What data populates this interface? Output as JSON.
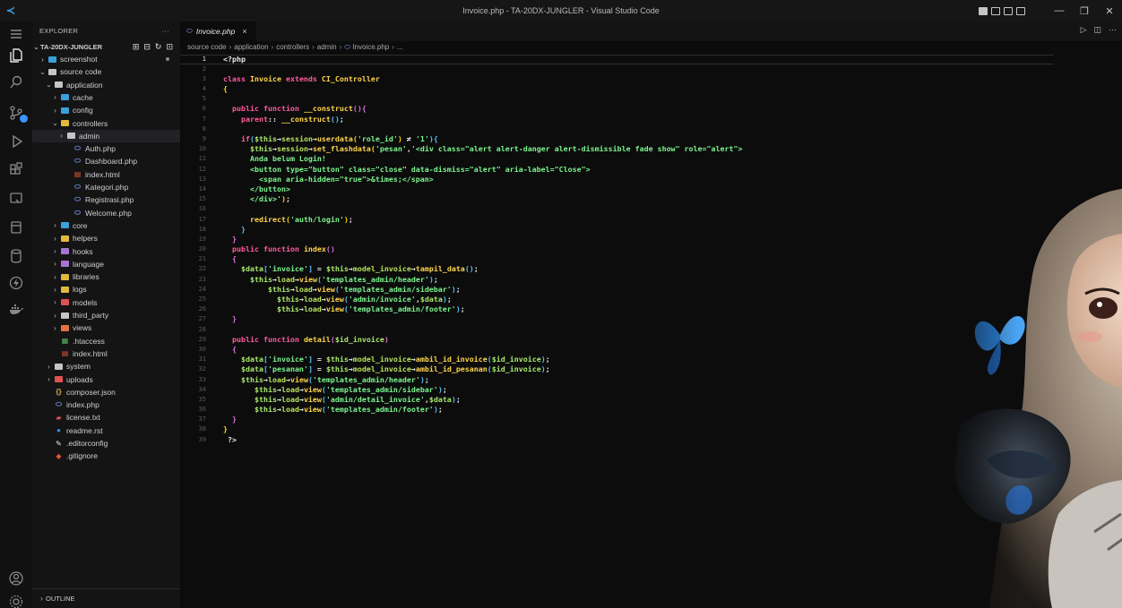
{
  "window": {
    "title": "Invoice.php - TA-20DX-JUNGLER - Visual Studio Code"
  },
  "explorer": {
    "header": "EXPLORER",
    "more": "···",
    "root": "TA-20DX-JUNGLER",
    "items": [
      {
        "label": "screenshot",
        "depth": 1,
        "type": "folder",
        "open": false,
        "color": "#3aa0d8",
        "dot": true
      },
      {
        "label": "source code",
        "depth": 1,
        "type": "folder",
        "open": true,
        "color": "#c5c5c5"
      },
      {
        "label": "application",
        "depth": 2,
        "type": "folder",
        "open": true,
        "color": "#c5c5c5"
      },
      {
        "label": "cache",
        "depth": 3,
        "type": "folder",
        "open": false,
        "color": "#3aa0d8"
      },
      {
        "label": "config",
        "depth": 3,
        "type": "folder",
        "open": false,
        "color": "#3aa0d8"
      },
      {
        "label": "controllers",
        "depth": 3,
        "type": "folder",
        "open": true,
        "color": "#e2b93d"
      },
      {
        "label": "admin",
        "depth": 4,
        "type": "folder",
        "open": false,
        "color": "#c5c5c5",
        "selected": true
      },
      {
        "label": "Auth.php",
        "depth": 5,
        "type": "php"
      },
      {
        "label": "Dashboard.php",
        "depth": 5,
        "type": "php"
      },
      {
        "label": "index.html",
        "depth": 5,
        "type": "html"
      },
      {
        "label": "Kategori.php",
        "depth": 5,
        "type": "php"
      },
      {
        "label": "Registrasi.php",
        "depth": 5,
        "type": "php"
      },
      {
        "label": "Welcome.php",
        "depth": 5,
        "type": "php"
      },
      {
        "label": "core",
        "depth": 3,
        "type": "folder",
        "open": false,
        "color": "#3aa0d8"
      },
      {
        "label": "helpers",
        "depth": 3,
        "type": "folder",
        "open": false,
        "color": "#e2b93d"
      },
      {
        "label": "hooks",
        "depth": 3,
        "type": "folder",
        "open": false,
        "color": "#a774d6"
      },
      {
        "label": "language",
        "depth": 3,
        "type": "folder",
        "open": false,
        "color": "#a774d6"
      },
      {
        "label": "libraries",
        "depth": 3,
        "type": "folder",
        "open": false,
        "color": "#e2b93d"
      },
      {
        "label": "logs",
        "depth": 3,
        "type": "folder",
        "open": false,
        "color": "#e2b93d"
      },
      {
        "label": "models",
        "depth": 3,
        "type": "folder",
        "open": false,
        "color": "#e05252"
      },
      {
        "label": "third_party",
        "depth": 3,
        "type": "folder",
        "open": false,
        "color": "#c5c5c5"
      },
      {
        "label": "views",
        "depth": 3,
        "type": "folder",
        "open": false,
        "color": "#e2733d"
      },
      {
        "label": ".htaccess",
        "depth": 3,
        "type": "htaccess"
      },
      {
        "label": "index.html",
        "depth": 3,
        "type": "html"
      },
      {
        "label": "system",
        "depth": 2,
        "type": "folder",
        "open": false,
        "color": "#c5c5c5"
      },
      {
        "label": "uploads",
        "depth": 2,
        "type": "folder",
        "open": false,
        "color": "#e05252"
      },
      {
        "label": "composer.json",
        "depth": 2,
        "type": "json"
      },
      {
        "label": "index.php",
        "depth": 2,
        "type": "php"
      },
      {
        "label": "license.txt",
        "depth": 2,
        "type": "license"
      },
      {
        "label": "readme.rst",
        "depth": 2,
        "type": "info"
      },
      {
        "label": ".editorconfig",
        "depth": 2,
        "type": "editorconfig"
      },
      {
        "label": ".gitignore",
        "depth": 2,
        "type": "git"
      }
    ],
    "outline": "OUTLINE"
  },
  "tab": {
    "label": "Invoice.php",
    "close": "×"
  },
  "breadcrumb": [
    "source code",
    "application",
    "controllers",
    "admin",
    "Invoice.php",
    "..."
  ],
  "editor": {
    "active_line": 1,
    "lines": [
      [
        [
          "php-tag",
          "<?php"
        ]
      ],
      [],
      [
        [
          "kw",
          "class "
        ],
        [
          "cls",
          "Invoice "
        ],
        [
          "kw",
          "extends "
        ],
        [
          "cls",
          "CI_Controller"
        ]
      ],
      [
        [
          "brk1",
          "{"
        ]
      ],
      [],
      [
        [
          "t",
          "  "
        ],
        [
          "kw",
          "public function "
        ],
        [
          "fn",
          "__construct"
        ],
        [
          "brk2",
          "(){"
        ]
      ],
      [
        [
          "t",
          "    "
        ],
        [
          "kw",
          "parent"
        ],
        [
          "op",
          ":: "
        ],
        [
          "fn",
          "__construct"
        ],
        [
          "brk3",
          "()"
        ],
        [
          "op",
          ";"
        ]
      ],
      [],
      [
        [
          "t",
          "    "
        ],
        [
          "kw",
          "if"
        ],
        [
          "brk3",
          "("
        ],
        [
          "var",
          "$this"
        ],
        [
          "op",
          "→"
        ],
        [
          "prop",
          "session"
        ],
        [
          "op",
          "→"
        ],
        [
          "fn",
          "userdata"
        ],
        [
          "brk1",
          "("
        ],
        [
          "str",
          "'role_id'"
        ],
        [
          "brk1",
          ")"
        ],
        [
          "op",
          " ≠ "
        ],
        [
          "str",
          "'1'"
        ],
        [
          "brk3",
          ")"
        ],
        [
          "brk3",
          "{"
        ]
      ],
      [
        [
          "t",
          "      "
        ],
        [
          "var",
          "$this"
        ],
        [
          "op",
          "→"
        ],
        [
          "prop",
          "session"
        ],
        [
          "op",
          "→"
        ],
        [
          "fn",
          "set_flashdata"
        ],
        [
          "brk1",
          "("
        ],
        [
          "str",
          "'pesan'"
        ],
        [
          "op",
          ","
        ],
        [
          "str",
          "'<div class=\"alert alert-danger alert-dismissible fade show\" role=\"alert\">"
        ]
      ],
      [
        [
          "t",
          "      "
        ],
        [
          "str",
          "Anda belum Login!"
        ]
      ],
      [
        [
          "t",
          "      "
        ],
        [
          "str",
          "<button type=\"button\" class=\"close\" data-dismiss=\"alert\" aria-label=\"Close\">"
        ]
      ],
      [
        [
          "t",
          "        "
        ],
        [
          "str",
          "<span aria-hidden=\"true\">&times;</span>"
        ]
      ],
      [
        [
          "t",
          "      "
        ],
        [
          "str",
          "</button>"
        ]
      ],
      [
        [
          "t",
          "      "
        ],
        [
          "str",
          "</div>'"
        ],
        [
          "brk1",
          ")"
        ],
        [
          "op",
          ";"
        ]
      ],
      [],
      [
        [
          "t",
          "      "
        ],
        [
          "fn",
          "redirect"
        ],
        [
          "brk1",
          "("
        ],
        [
          "str",
          "'auth/login'"
        ],
        [
          "brk1",
          ")"
        ],
        [
          "op",
          ";"
        ]
      ],
      [
        [
          "t",
          "    "
        ],
        [
          "brk3",
          "}"
        ]
      ],
      [
        [
          "t",
          "  "
        ],
        [
          "brk2",
          "}"
        ]
      ],
      [
        [
          "t",
          "  "
        ],
        [
          "kw",
          "public function "
        ],
        [
          "fn",
          "index"
        ],
        [
          "brk2",
          "()"
        ]
      ],
      [
        [
          "t",
          "  "
        ],
        [
          "brk2",
          "{"
        ]
      ],
      [
        [
          "t",
          "    "
        ],
        [
          "var",
          "$data"
        ],
        [
          "brk3",
          "["
        ],
        [
          "str",
          "'invoice'"
        ],
        [
          "brk3",
          "]"
        ],
        [
          "op",
          " = "
        ],
        [
          "var",
          "$this"
        ],
        [
          "op",
          "→"
        ],
        [
          "prop",
          "model_invoice"
        ],
        [
          "op",
          "→"
        ],
        [
          "fn",
          "tampil_data"
        ],
        [
          "brk3",
          "()"
        ],
        [
          "op",
          ";"
        ]
      ],
      [
        [
          "t",
          "      "
        ],
        [
          "var",
          "$this"
        ],
        [
          "op",
          "→"
        ],
        [
          "prop",
          "load"
        ],
        [
          "op",
          "→"
        ],
        [
          "fn",
          "view"
        ],
        [
          "brk3",
          "("
        ],
        [
          "str",
          "'templates_admin/header'"
        ],
        [
          "brk3",
          ")"
        ],
        [
          "op",
          ";"
        ]
      ],
      [
        [
          "t",
          "          "
        ],
        [
          "var",
          "$this"
        ],
        [
          "op",
          "→"
        ],
        [
          "prop",
          "load"
        ],
        [
          "op",
          "→"
        ],
        [
          "fn",
          "view"
        ],
        [
          "brk3",
          "("
        ],
        [
          "str",
          "'templates_admin/sidebar'"
        ],
        [
          "brk3",
          ")"
        ],
        [
          "op",
          ";"
        ]
      ],
      [
        [
          "t",
          "            "
        ],
        [
          "var",
          "$this"
        ],
        [
          "op",
          "→"
        ],
        [
          "prop",
          "load"
        ],
        [
          "op",
          "→"
        ],
        [
          "fn",
          "view"
        ],
        [
          "brk3",
          "("
        ],
        [
          "str",
          "'admin/invoice'"
        ],
        [
          "op",
          ","
        ],
        [
          "var",
          "$data"
        ],
        [
          "brk3",
          ")"
        ],
        [
          "op",
          ";"
        ]
      ],
      [
        [
          "t",
          "            "
        ],
        [
          "var",
          "$this"
        ],
        [
          "op",
          "→"
        ],
        [
          "prop",
          "load"
        ],
        [
          "op",
          "→"
        ],
        [
          "fn",
          "view"
        ],
        [
          "brk3",
          "("
        ],
        [
          "str",
          "'templates_admin/footer'"
        ],
        [
          "brk3",
          ")"
        ],
        [
          "op",
          ";"
        ]
      ],
      [
        [
          "t",
          "  "
        ],
        [
          "brk2",
          "}"
        ]
      ],
      [],
      [
        [
          "t",
          "  "
        ],
        [
          "kw",
          "public function "
        ],
        [
          "fn",
          "detail"
        ],
        [
          "brk2",
          "("
        ],
        [
          "var",
          "$id_invoice"
        ],
        [
          "brk2",
          ")"
        ]
      ],
      [
        [
          "t",
          "  "
        ],
        [
          "brk2",
          "{"
        ]
      ],
      [
        [
          "t",
          "    "
        ],
        [
          "var",
          "$data"
        ],
        [
          "brk3",
          "["
        ],
        [
          "str",
          "'invoice'"
        ],
        [
          "brk3",
          "]"
        ],
        [
          "op",
          " = "
        ],
        [
          "var",
          "$this"
        ],
        [
          "op",
          "→"
        ],
        [
          "prop",
          "model_invoice"
        ],
        [
          "op",
          "→"
        ],
        [
          "fn",
          "ambil_id_invoice"
        ],
        [
          "brk3",
          "("
        ],
        [
          "var",
          "$id_invoice"
        ],
        [
          "brk3",
          ")"
        ],
        [
          "op",
          ";"
        ]
      ],
      [
        [
          "t",
          "    "
        ],
        [
          "var",
          "$data"
        ],
        [
          "brk3",
          "["
        ],
        [
          "str",
          "'pesanan'"
        ],
        [
          "brk3",
          "]"
        ],
        [
          "op",
          " = "
        ],
        [
          "var",
          "$this"
        ],
        [
          "op",
          "→"
        ],
        [
          "prop",
          "model_invoice"
        ],
        [
          "op",
          "→"
        ],
        [
          "fn",
          "ambil_id_pesanan"
        ],
        [
          "brk3",
          "("
        ],
        [
          "var",
          "$id_invoice"
        ],
        [
          "brk3",
          ")"
        ],
        [
          "op",
          ";"
        ]
      ],
      [
        [
          "t",
          "    "
        ],
        [
          "var",
          "$this"
        ],
        [
          "op",
          "→"
        ],
        [
          "prop",
          "load"
        ],
        [
          "op",
          "→"
        ],
        [
          "fn",
          "view"
        ],
        [
          "brk3",
          "("
        ],
        [
          "str",
          "'templates_admin/header'"
        ],
        [
          "brk3",
          ")"
        ],
        [
          "op",
          ";"
        ]
      ],
      [
        [
          "t",
          "       "
        ],
        [
          "var",
          "$this"
        ],
        [
          "op",
          "→"
        ],
        [
          "prop",
          "load"
        ],
        [
          "op",
          "→"
        ],
        [
          "fn",
          "view"
        ],
        [
          "brk3",
          "("
        ],
        [
          "str",
          "'templates_admin/sidebar'"
        ],
        [
          "brk3",
          ")"
        ],
        [
          "op",
          ";"
        ]
      ],
      [
        [
          "t",
          "       "
        ],
        [
          "var",
          "$this"
        ],
        [
          "op",
          "→"
        ],
        [
          "prop",
          "load"
        ],
        [
          "op",
          "→"
        ],
        [
          "fn",
          "view"
        ],
        [
          "brk3",
          "("
        ],
        [
          "str",
          "'admin/detail_invoice'"
        ],
        [
          "op",
          ","
        ],
        [
          "var",
          "$data"
        ],
        [
          "brk3",
          ")"
        ],
        [
          "op",
          ";"
        ]
      ],
      [
        [
          "t",
          "       "
        ],
        [
          "var",
          "$this"
        ],
        [
          "op",
          "→"
        ],
        [
          "prop",
          "load"
        ],
        [
          "op",
          "→"
        ],
        [
          "fn",
          "view"
        ],
        [
          "brk3",
          "("
        ],
        [
          "str",
          "'templates_admin/footer'"
        ],
        [
          "brk3",
          ")"
        ],
        [
          "op",
          ";"
        ]
      ],
      [
        [
          "t",
          "  "
        ],
        [
          "brk2",
          "}"
        ]
      ],
      [
        [
          "brk1",
          "}"
        ]
      ],
      [
        [
          "t",
          " "
        ],
        [
          "php-tag",
          "?>"
        ]
      ]
    ]
  }
}
